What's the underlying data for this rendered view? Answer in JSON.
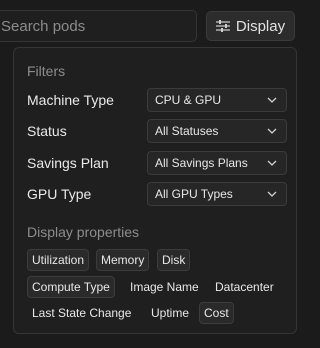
{
  "search": {
    "text": "Search pods"
  },
  "display_button": {
    "label": "Display",
    "icon": "sliders-icon"
  },
  "popover": {
    "filters_title": "Filters",
    "filters": [
      {
        "label": "Machine Type",
        "value": "CPU & GPU"
      },
      {
        "label": "Status",
        "value": "All Statuses"
      },
      {
        "label": "Savings Plan",
        "value": "All Savings Plans"
      },
      {
        "label": "GPU Type",
        "value": "All GPU Types"
      }
    ],
    "properties_title": "Display properties",
    "properties": [
      {
        "label": "Utilization",
        "active": true
      },
      {
        "label": "Memory",
        "active": true
      },
      {
        "label": "Disk",
        "active": true
      },
      {
        "label": "Compute Type",
        "active": true
      },
      {
        "label": "Image Name",
        "active": false
      },
      {
        "label": "Datacenter",
        "active": false
      },
      {
        "label": "Last State Change",
        "active": false
      },
      {
        "label": "Uptime",
        "active": false
      },
      {
        "label": "Cost",
        "active": true
      }
    ]
  },
  "colors": {
    "background": "#1b1b1b",
    "panel": "#1f1f1f",
    "border": "#353535",
    "muted_text": "#8d8d8d"
  }
}
